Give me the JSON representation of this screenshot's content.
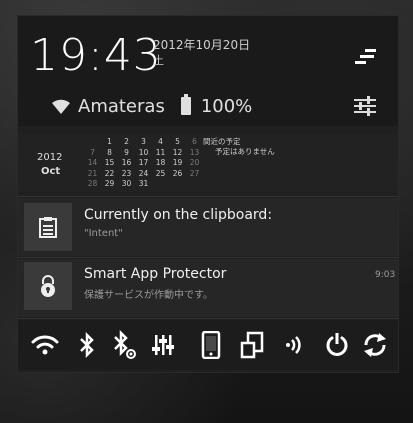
{
  "status": {
    "time": "19:43",
    "date": "2012年10月20日",
    "weekday": "土",
    "wifi_name": "Amateras",
    "battery": "100%"
  },
  "calendar": {
    "year": "2012",
    "month": "Oct",
    "days": [
      [
        "",
        "1",
        "2",
        "3",
        "4",
        "5",
        "6"
      ],
      [
        "7",
        "8",
        "9",
        "10",
        "11",
        "12",
        "13"
      ],
      [
        "14",
        "15",
        "16",
        "17",
        "18",
        "19",
        "20"
      ],
      [
        "21",
        "22",
        "23",
        "24",
        "25",
        "26",
        "27"
      ],
      [
        "28",
        "29",
        "30",
        "31",
        "",
        "",
        ""
      ]
    ],
    "events_header": "間近の予定",
    "events_empty": "予定はありません"
  },
  "notifications": [
    {
      "title": "Currently on the clipboard:",
      "subtitle": "\"Intent\"",
      "time": "",
      "icon": "clipboard-icon"
    },
    {
      "title": "Smart App Protector",
      "subtitle": "保護サービスが作動中です。",
      "time": "9:03",
      "icon": "lock-icon"
    }
  ],
  "toggles": [
    "wifi-icon",
    "bluetooth-icon",
    "bluetooth-settings-icon",
    "equalizer-icon",
    "phone-icon",
    "rotate-icon",
    "sound-icon",
    "power-icon",
    "sync-icon"
  ],
  "colors": {
    "background": "#181818",
    "panel": "#202020",
    "text": "#e8e8e8",
    "icon": "#ffffff"
  }
}
